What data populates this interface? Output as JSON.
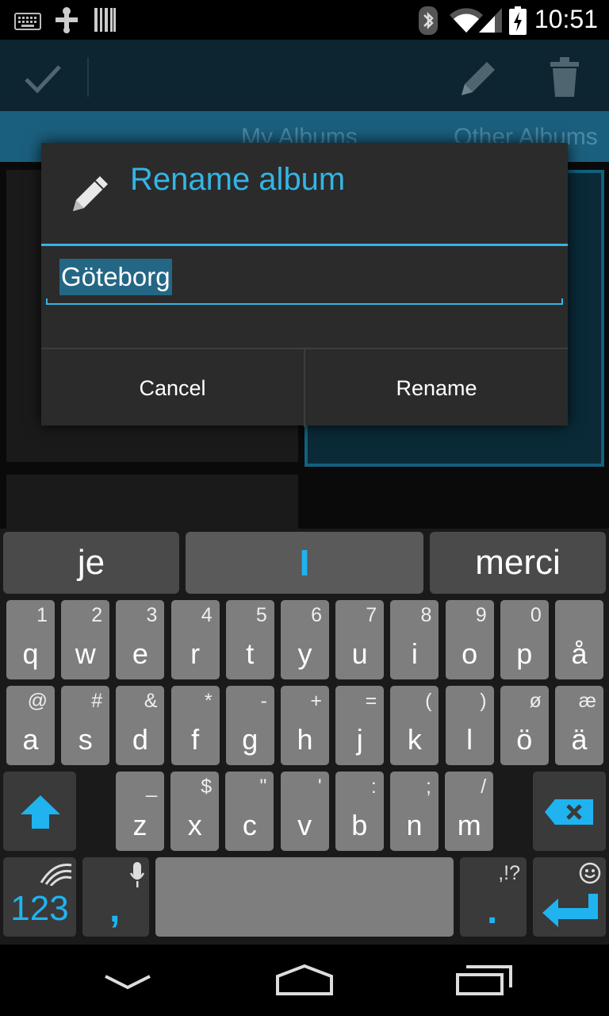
{
  "status_bar": {
    "time": "10:51",
    "icons": [
      "keyboard-icon",
      "usb-icon",
      "barcode-icon",
      "bluetooth-icon",
      "wifi-icon",
      "signal-icon",
      "battery-charging-icon"
    ]
  },
  "action_bar": {
    "icons": [
      "checkmark-icon",
      "pencil-icon",
      "trash-icon"
    ]
  },
  "tabs": [
    "My Albums",
    "Other Albums"
  ],
  "dialog": {
    "title": "Rename album",
    "title_icon": "pencil-icon",
    "input_value": "Göteborg",
    "cancel_label": "Cancel",
    "rename_label": "Rename"
  },
  "keyboard": {
    "suggestions": [
      "je",
      "I",
      "merci"
    ],
    "row1": [
      {
        "main": "q",
        "sec": "1"
      },
      {
        "main": "w",
        "sec": "2"
      },
      {
        "main": "e",
        "sec": "3"
      },
      {
        "main": "r",
        "sec": "4"
      },
      {
        "main": "t",
        "sec": "5"
      },
      {
        "main": "y",
        "sec": "6"
      },
      {
        "main": "u",
        "sec": "7"
      },
      {
        "main": "i",
        "sec": "8"
      },
      {
        "main": "o",
        "sec": "9"
      },
      {
        "main": "p",
        "sec": "0"
      },
      {
        "main": "å",
        "sec": ""
      }
    ],
    "row2": [
      {
        "main": "a",
        "sec": "@"
      },
      {
        "main": "s",
        "sec": "#"
      },
      {
        "main": "d",
        "sec": "&"
      },
      {
        "main": "f",
        "sec": "*"
      },
      {
        "main": "g",
        "sec": "-"
      },
      {
        "main": "h",
        "sec": "+"
      },
      {
        "main": "j",
        "sec": "="
      },
      {
        "main": "k",
        "sec": "("
      },
      {
        "main": "l",
        "sec": ")"
      },
      {
        "main": "ö",
        "sec": "ø"
      },
      {
        "main": "ä",
        "sec": "æ"
      }
    ],
    "row3": [
      {
        "main": "z",
        "sec": "_"
      },
      {
        "main": "x",
        "sec": "$"
      },
      {
        "main": "c",
        "sec": "\""
      },
      {
        "main": "v",
        "sec": "'"
      },
      {
        "main": "b",
        "sec": ":"
      },
      {
        "main": "n",
        "sec": ";"
      },
      {
        "main": "m",
        "sec": "/"
      }
    ],
    "num_label": "123",
    "comma_label": ",",
    "period_label": ".",
    "period_sec": ",!?",
    "accent_color": "#1fb3f0"
  },
  "nav_bar": {
    "icons": [
      "back-icon",
      "home-icon",
      "recents-icon"
    ]
  }
}
